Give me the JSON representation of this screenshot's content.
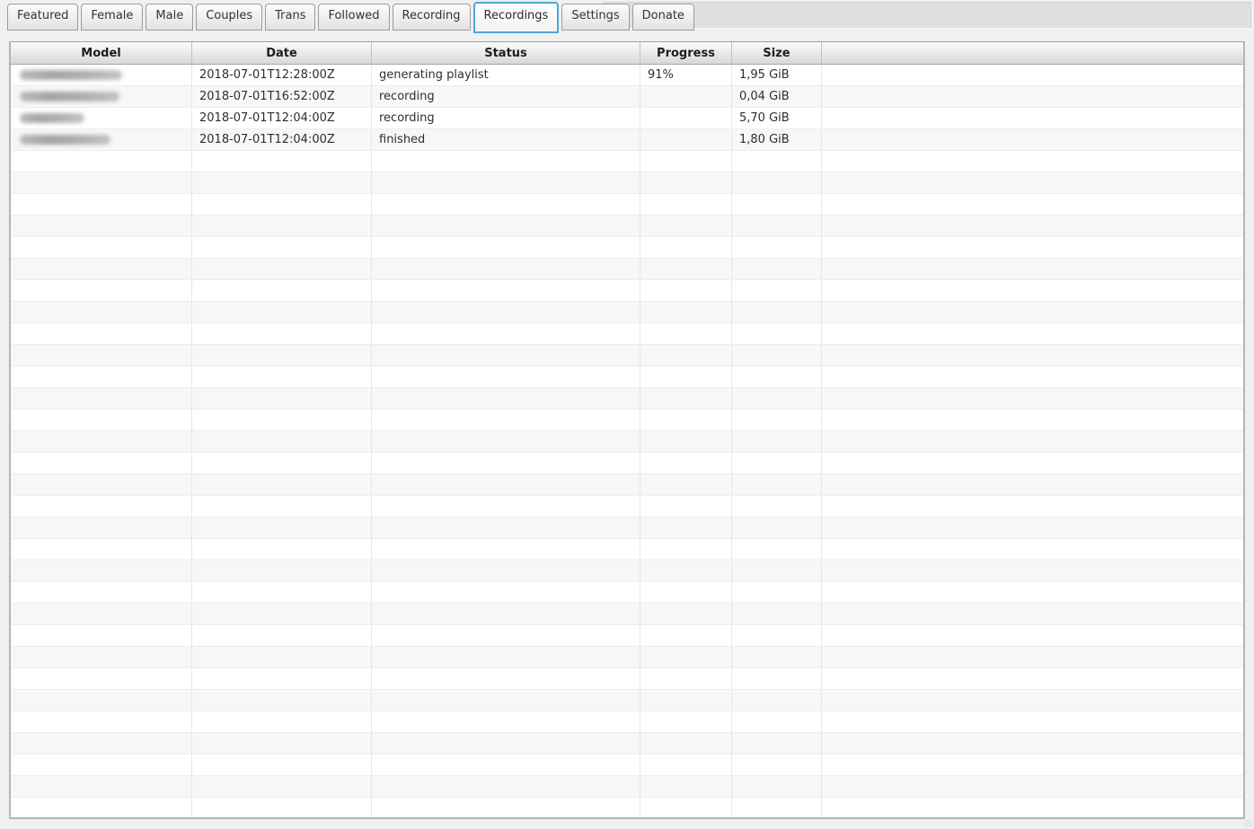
{
  "colors": {
    "accent": "#4ea7d7",
    "page_background": "#f0f0f0",
    "row_alt": "#f7f7f7"
  },
  "tabs": [
    {
      "label": "Featured",
      "active": false
    },
    {
      "label": "Female",
      "active": false
    },
    {
      "label": "Male",
      "active": false
    },
    {
      "label": "Couples",
      "active": false
    },
    {
      "label": "Trans",
      "active": false
    },
    {
      "label": "Followed",
      "active": false
    },
    {
      "label": "Recording",
      "active": false
    },
    {
      "label": "Recordings",
      "active": true
    },
    {
      "label": "Settings",
      "active": false
    },
    {
      "label": "Donate",
      "active": false
    }
  ],
  "table": {
    "columns": [
      {
        "id": "model",
        "label": "Model"
      },
      {
        "id": "date",
        "label": "Date"
      },
      {
        "id": "status",
        "label": "Status"
      },
      {
        "id": "progress",
        "label": "Progress"
      },
      {
        "id": "size",
        "label": "Size"
      },
      {
        "id": "filler",
        "label": ""
      }
    ],
    "rows": [
      {
        "model_redacted": true,
        "model_blur_width": 114,
        "date": "2018-07-01T12:28:00Z",
        "status": "generating playlist",
        "progress": "91%",
        "size": "1,95 GiB"
      },
      {
        "model_redacted": true,
        "model_blur_width": 111,
        "date": "2018-07-01T16:52:00Z",
        "status": "recording",
        "progress": "",
        "size": "0,04 GiB"
      },
      {
        "model_redacted": true,
        "model_blur_width": 72,
        "date": "2018-07-01T12:04:00Z",
        "status": "recording",
        "progress": "",
        "size": "5,70 GiB"
      },
      {
        "model_redacted": true,
        "model_blur_width": 101,
        "date": "2018-07-01T12:04:00Z",
        "status": "finished",
        "progress": "",
        "size": "1,80 GiB"
      }
    ],
    "empty_row_count": 31
  }
}
